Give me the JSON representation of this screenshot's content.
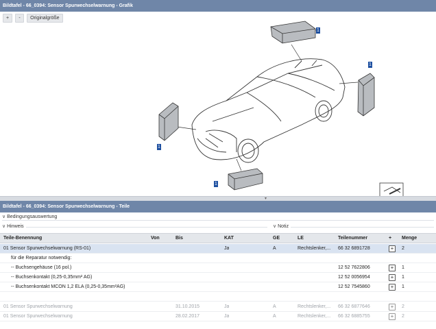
{
  "graphic_panel": {
    "title": "Bildtafel - 66_0394: Sensor Spurwechselwarnung - Grafik",
    "buttons": {
      "zoom_in": "+",
      "zoom_out": "-",
      "original_size": "Originalgröße"
    },
    "callouts": [
      "1",
      "1",
      "1",
      "1"
    ]
  },
  "parts_panel": {
    "title": "Bildtafel - 66_0394: Sensor Spurwechselwarnung - Teile",
    "condition_label": "Bedingungsauswertung",
    "hint_label": "Hinweis",
    "note_label": "Notiz",
    "columns": [
      "Teile-Benennung",
      "Von",
      "Bis",
      "KAT",
      "GE",
      "LE",
      "Teilenummer",
      "+",
      "Menge"
    ],
    "rows": [
      {
        "name": "01 Sensor Spurwechselwarnung (RS-01)",
        "von": "",
        "bis": "",
        "kat": "Ja",
        "ge": "A",
        "le": "Rechtslenker,...",
        "nummer": "66 32 6891728",
        "menge": "2",
        "plus": true,
        "state": "selected"
      },
      {
        "name": "für die Reparatur notwendig:",
        "von": "",
        "bis": "",
        "kat": "",
        "ge": "",
        "le": "",
        "nummer": "",
        "menge": "",
        "plus": false,
        "state": "indent"
      },
      {
        "name": "-- Buchsengehäuse (16 pol.)",
        "von": "",
        "bis": "",
        "kat": "",
        "ge": "",
        "le": "",
        "nummer": "12 52 7622806",
        "menge": "1",
        "plus": true,
        "state": "indent"
      },
      {
        "name": "-- Buchsenkontakt (0,25-0,35mm² AG)",
        "von": "",
        "bis": "",
        "kat": "",
        "ge": "",
        "le": "",
        "nummer": "12 52 0056954",
        "menge": "1",
        "plus": true,
        "state": "indent"
      },
      {
        "name": "-- Buchsenkontakt MCON 1,2 ELA (0,25-0,35mm²AG)",
        "von": "",
        "bis": "",
        "kat": "",
        "ge": "",
        "le": "",
        "nummer": "12 52 7545860",
        "menge": "1",
        "plus": true,
        "state": "indent"
      },
      {
        "name": "",
        "von": "",
        "bis": "",
        "kat": "",
        "ge": "",
        "le": "",
        "nummer": "",
        "menge": "",
        "plus": false,
        "state": "empty"
      },
      {
        "name": "01 Sensor Spurwechselwarnung",
        "von": "",
        "bis": "31.10.2015",
        "kat": "Ja",
        "ge": "A",
        "le": "Rechtslenker,...",
        "nummer": "66 32 6877646",
        "menge": "2",
        "plus": true,
        "state": "gray"
      },
      {
        "name": "01 Sensor Spurwechselwarnung",
        "von": "",
        "bis": "28.02.2017",
        "kat": "Ja",
        "ge": "A",
        "le": "Rechtslenker,...",
        "nummer": "66 32 6885755",
        "menge": "2",
        "plus": true,
        "state": "gray"
      }
    ]
  }
}
